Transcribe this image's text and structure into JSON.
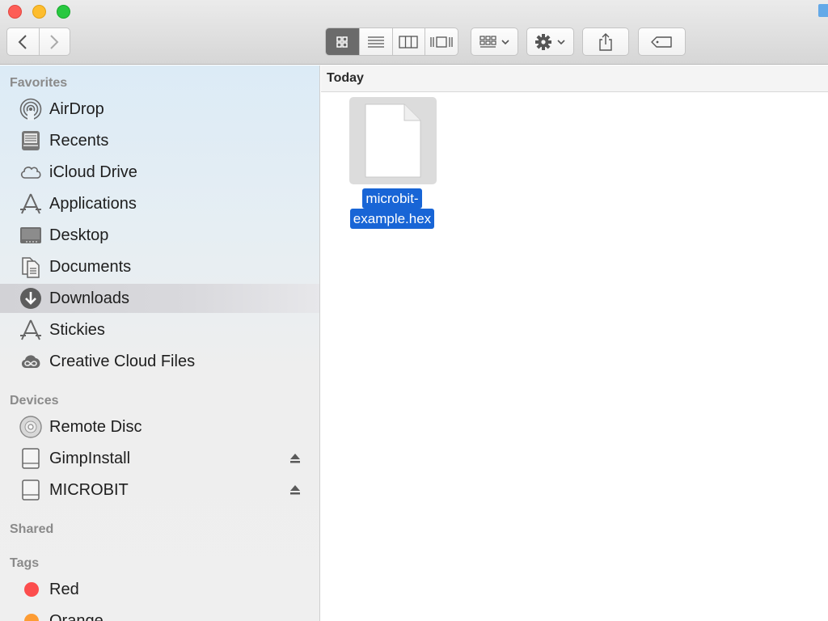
{
  "window": {
    "accent_color": "#1865d6"
  },
  "toolbar": {
    "back_icon": "chevron-left-icon",
    "forward_icon": "chevron-right-icon",
    "view_modes": [
      "icon-view",
      "list-view",
      "column-view",
      "cover-flow-view"
    ],
    "active_view": "icon-view",
    "arrange_icon": "arrange-grid-icon",
    "action_icon": "gear-icon",
    "share_icon": "share-icon",
    "tag_icon": "tag-icon"
  },
  "sidebar": {
    "favorites_header": "Favorites",
    "favorites": [
      {
        "label": "AirDrop",
        "icon": "airdrop-icon"
      },
      {
        "label": "Recents",
        "icon": "recents-icon"
      },
      {
        "label": "iCloud Drive",
        "icon": "cloud-icon"
      },
      {
        "label": "Applications",
        "icon": "applications-icon"
      },
      {
        "label": "Desktop",
        "icon": "desktop-icon"
      },
      {
        "label": "Documents",
        "icon": "documents-icon"
      },
      {
        "label": "Downloads",
        "icon": "downloads-icon",
        "selected": true
      },
      {
        "label": "Stickies",
        "icon": "applications-icon"
      },
      {
        "label": "Creative Cloud Files",
        "icon": "creative-cloud-icon"
      }
    ],
    "devices_header": "Devices",
    "devices": [
      {
        "label": "Remote Disc",
        "icon": "disc-icon",
        "eject": false
      },
      {
        "label": "GimpInstall",
        "icon": "drive-icon",
        "eject": true
      },
      {
        "label": "MICROBIT",
        "icon": "drive-icon",
        "eject": true
      }
    ],
    "shared_header": "Shared",
    "tags_header": "Tags",
    "tags": [
      {
        "label": "Red",
        "color": "#fc4d4d"
      },
      {
        "label": "Orange",
        "color": "#fd9c33"
      }
    ]
  },
  "content": {
    "group_header": "Today",
    "files": [
      {
        "name_line1": "microbit-",
        "name_line2": "example.hex",
        "selected": true,
        "icon": "document-icon"
      }
    ]
  }
}
